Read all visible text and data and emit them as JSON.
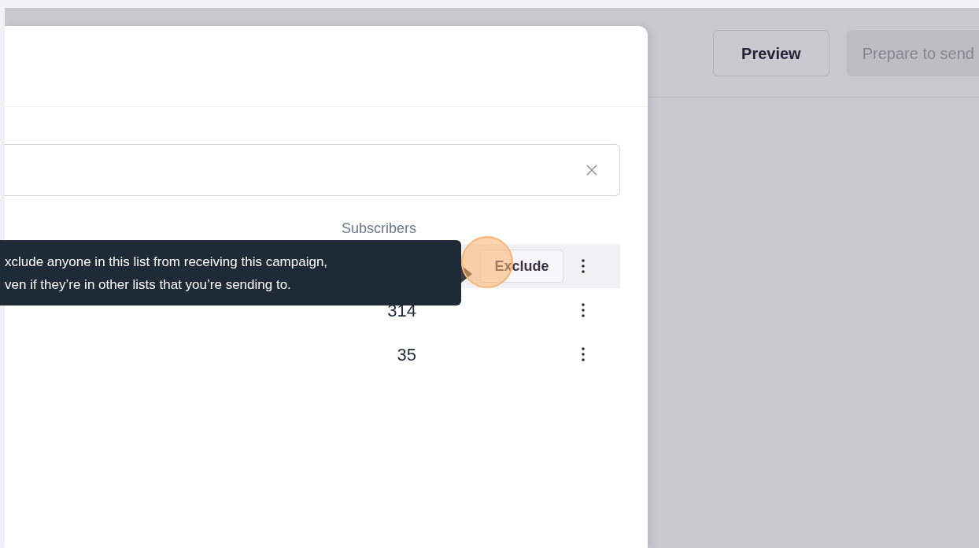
{
  "toolbar": {
    "buttons": [
      {
        "label": "Preview",
        "disabled": false
      },
      {
        "label": "Prepare to send",
        "disabled": true
      }
    ]
  },
  "dialog": {
    "table": {
      "columns": [
        "Subscribers"
      ],
      "rows": [
        {
          "hovered": true,
          "action": "Exclude"
        },
        {
          "subscribers": "314",
          "hovered": false
        },
        {
          "subscribers": "35",
          "hovered": false
        }
      ]
    },
    "tooltip": {
      "lines": [
        "xclude anyone in this list from receiving this campaign,",
        "ven if they’re in other lists that you’re sending to."
      ]
    }
  }
}
